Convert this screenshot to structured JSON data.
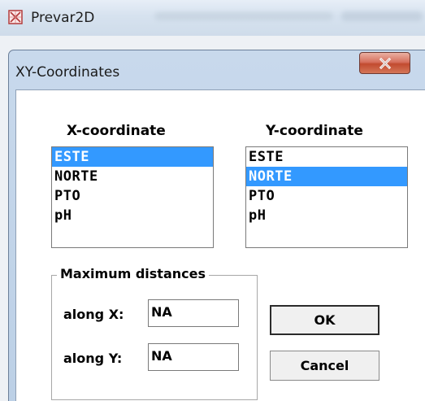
{
  "app": {
    "title": "Prevar2D",
    "icon": "app-window-icon"
  },
  "dialog": {
    "title": "XY-Coordinates",
    "close_icon": "close-icon",
    "x_column": {
      "label": "X-coordinate",
      "items": [
        "ESTE",
        "NORTE",
        "PTO",
        "pH"
      ],
      "selected": "ESTE"
    },
    "y_column": {
      "label": "Y-coordinate",
      "items": [
        "ESTE",
        "NORTE",
        "PTO",
        "pH"
      ],
      "selected": "NORTE"
    },
    "max_distances": {
      "label": "Maximum distances",
      "along_x_label": "along X:",
      "along_x_value": "NA",
      "along_y_label": "along Y:",
      "along_y_value": "NA"
    },
    "ok_label": "OK",
    "cancel_label": "Cancel"
  },
  "colors": {
    "selection": "#3399ff",
    "close_button": "#c94c30"
  }
}
